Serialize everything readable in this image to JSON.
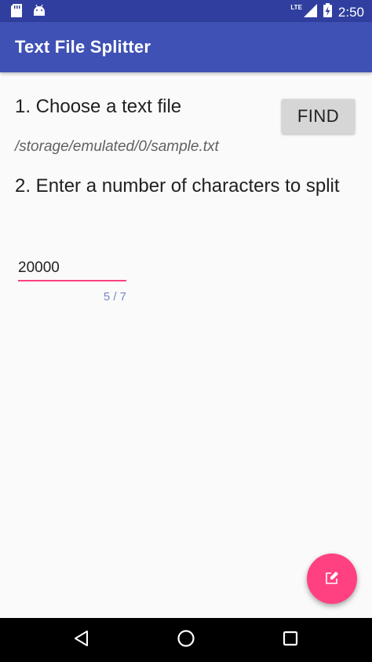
{
  "status_bar": {
    "time": "2:50",
    "network_label": "LTE",
    "icons": [
      "sd-card-icon",
      "android-icon",
      "signal-icon",
      "battery-charging-icon"
    ]
  },
  "app_bar": {
    "title": "Text File Splitter"
  },
  "step1": {
    "label": "1. Choose a text file",
    "find_button_label": "FIND",
    "file_path": "/storage/emulated/0/sample.txt"
  },
  "step2": {
    "label": "2. Enter a number of characters to split",
    "input_value": "20000",
    "counter": "5 / 7"
  },
  "fab": {
    "icon": "edit-icon"
  },
  "nav_bar": {
    "buttons": [
      "back-icon",
      "home-icon",
      "recents-icon"
    ]
  },
  "colors": {
    "primary": "#3f51b5",
    "primary_dark": "#303f9f",
    "accent": "#ff4081"
  }
}
